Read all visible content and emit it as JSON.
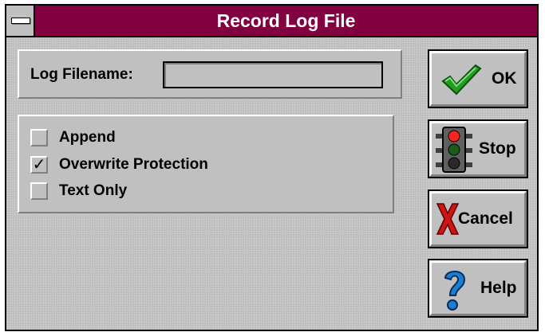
{
  "window": {
    "title": "Record Log File"
  },
  "filename": {
    "label": "Log Filename:",
    "value": "",
    "placeholder": ""
  },
  "options": [
    {
      "label": "Append",
      "checked": false
    },
    {
      "label": "Overwrite Protection",
      "checked": true
    },
    {
      "label": "Text Only",
      "checked": false
    }
  ],
  "check_mark": "✓",
  "buttons": {
    "ok": {
      "label": "OK",
      "icon": "checkmark-icon"
    },
    "stop": {
      "label": "Stop",
      "icon": "traffic-light-icon"
    },
    "cancel": {
      "label": "Cancel",
      "icon": "red-x-icon"
    },
    "help": {
      "label": "Help",
      "icon": "question-mark-icon"
    }
  },
  "colors": {
    "titlebar": "#800040",
    "face": "#c0c0c0",
    "ok_check": "#22aa22",
    "cancel_x": "#cc1111",
    "help_q": "#1a7fd0"
  }
}
